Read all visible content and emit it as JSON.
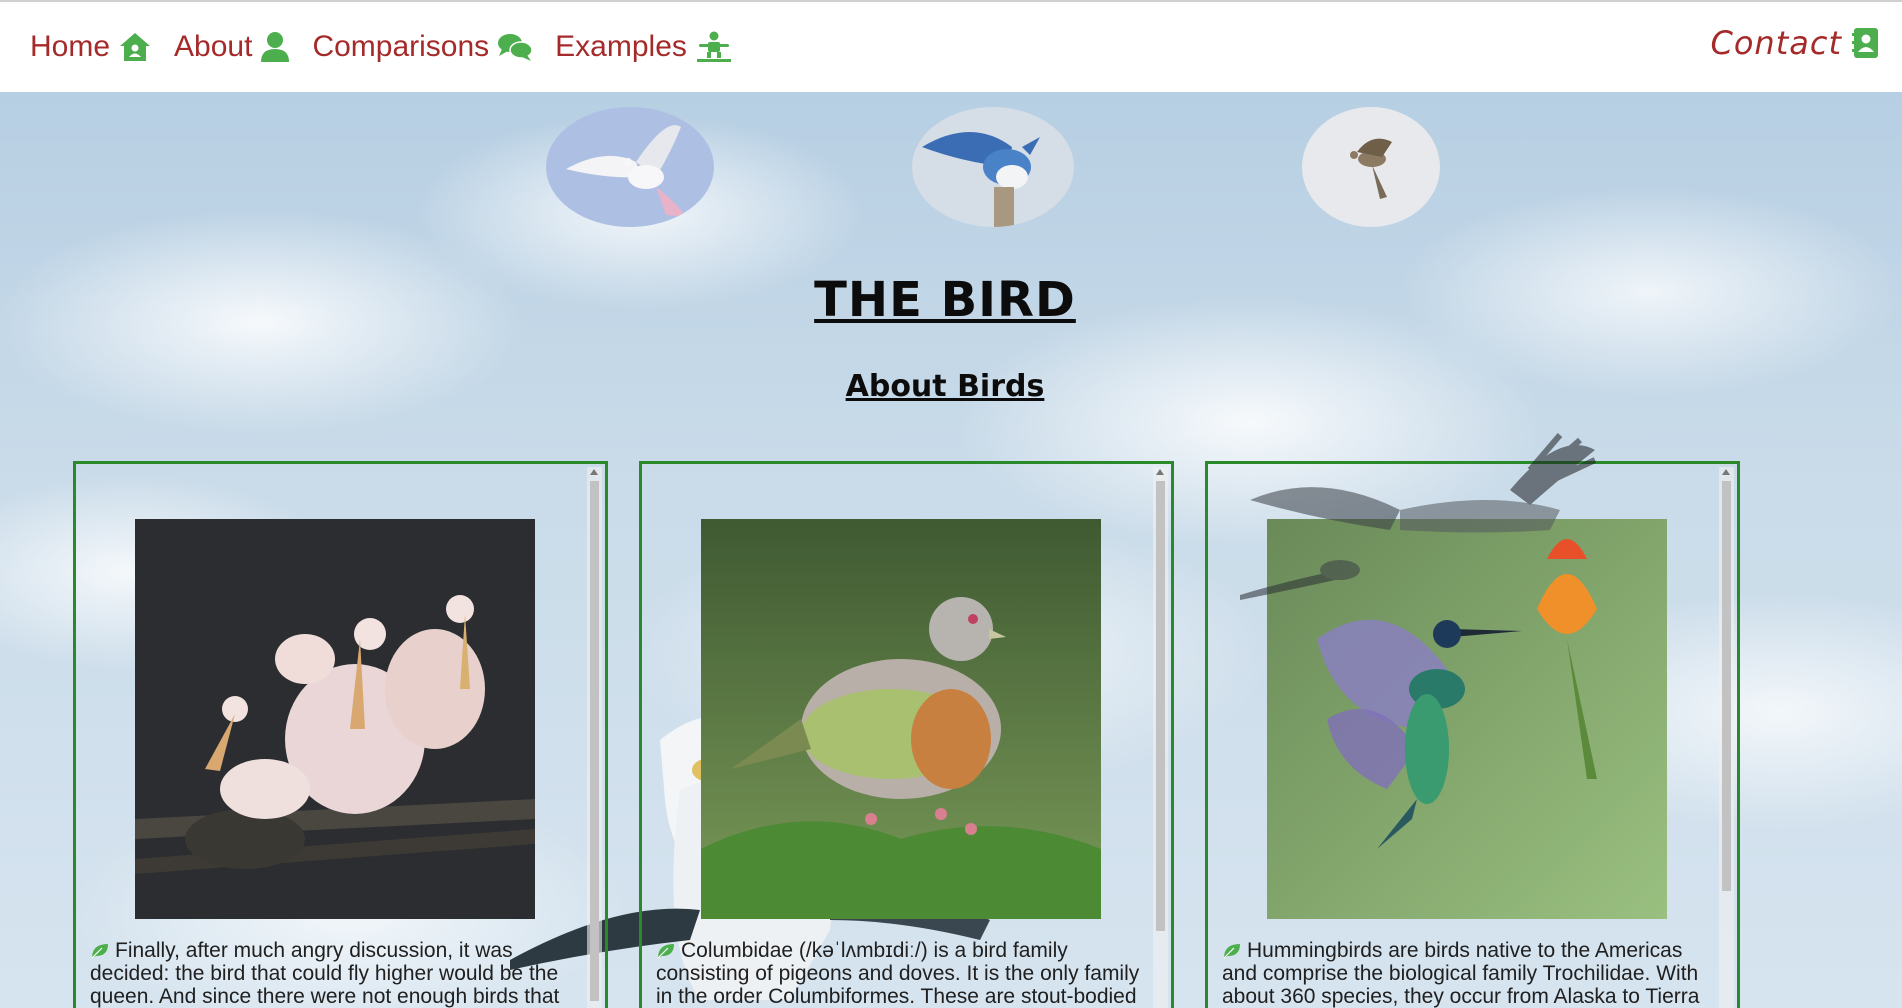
{
  "nav": {
    "items": [
      {
        "label": "Home",
        "icon": "home-icon"
      },
      {
        "label": "About",
        "icon": "user-icon"
      },
      {
        "label": "Comparisons",
        "icon": "comments-icon"
      },
      {
        "label": "Examples",
        "icon": "child-icon"
      }
    ],
    "contact": {
      "label": "Contact",
      "icon": "address-book-icon"
    }
  },
  "colors": {
    "nav_text": "#a52a2a",
    "icon_green": "#4cae4c",
    "card_border": "#2a8a2a"
  },
  "thumbnails": [
    {
      "name": "white-dove"
    },
    {
      "name": "blue-jay"
    },
    {
      "name": "small-bird"
    }
  ],
  "header": {
    "title": "THE BIRD",
    "subtitle": "About Birds"
  },
  "cards": [
    {
      "photo": "pelicans",
      "text": "Finally, after much angry discussion, it was decided: the bird that could fly higher would be the queen. And since there were not enough birds that"
    },
    {
      "photo": "green-pigeon",
      "text": "Columbidae (/kəˈlʌmbɪdiː/) is a bird family consisting of pigeons and doves. It is the only family in the order Columbiformes. These are stout-bodied"
    },
    {
      "photo": "hummingbird",
      "text": "Hummingbirds are birds native to the Americas and comprise the biological family Trochilidae. With about 360 species, they occur from Alaska to Tierra del"
    }
  ]
}
